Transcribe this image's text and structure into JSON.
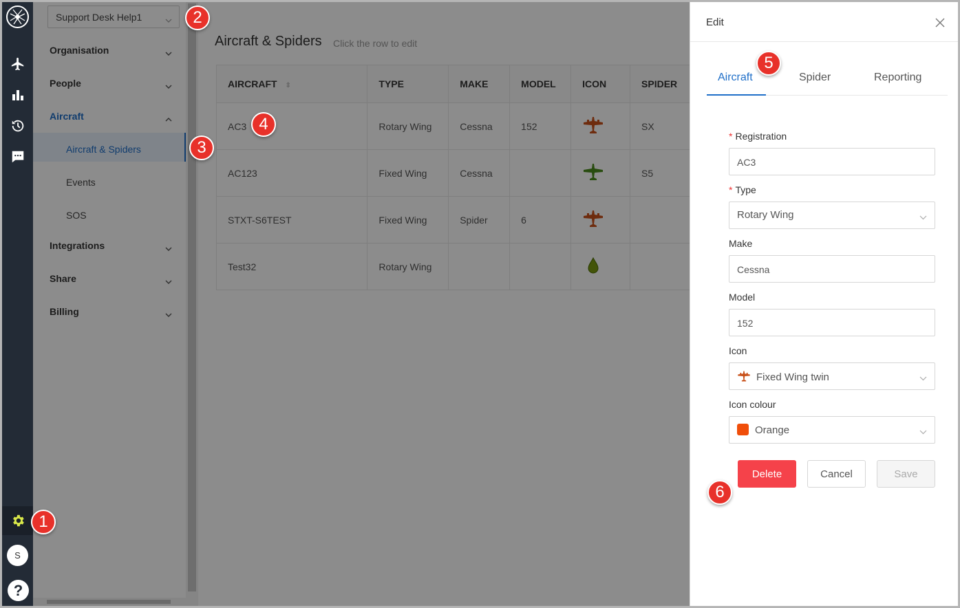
{
  "workspace": {
    "name": "Support Desk Help1"
  },
  "nav": {
    "groups": [
      {
        "label": "Organisation"
      },
      {
        "label": "People"
      },
      {
        "label": "Aircraft"
      },
      {
        "label": "Integrations"
      },
      {
        "label": "Share"
      },
      {
        "label": "Billing"
      }
    ],
    "aircraft_items": [
      {
        "label": "Aircraft & Spiders"
      },
      {
        "label": "Events"
      },
      {
        "label": "SOS"
      }
    ]
  },
  "user": {
    "initial": "S"
  },
  "help": {
    "glyph": "?"
  },
  "main": {
    "title": "Aircraft & Spiders",
    "hint": "Click the row to edit",
    "columns": [
      "AIRCRAFT",
      "TYPE",
      "MAKE",
      "MODEL",
      "ICON",
      "SPIDER"
    ],
    "rows": [
      {
        "aircraft": "AC3",
        "type": "Rotary Wing",
        "make": "Cessna",
        "model": "152",
        "icon": "orange-plane-icon",
        "spider": "SX"
      },
      {
        "aircraft": "AC123",
        "type": "Fixed Wing",
        "make": "Cessna",
        "model": "",
        "icon": "green-plane-icon",
        "spider": "S5"
      },
      {
        "aircraft": "STXT-S6TEST",
        "type": "Fixed Wing",
        "make": "Spider",
        "model": "6",
        "icon": "orange-plane-icon",
        "spider": ""
      },
      {
        "aircraft": "Test32",
        "type": "Rotary Wing",
        "make": "",
        "model": "",
        "icon": "green-drop-icon",
        "spider": ""
      }
    ]
  },
  "drawer": {
    "title": "Edit",
    "tabs": [
      "Aircraft",
      "Spider",
      "Reporting"
    ],
    "fields": {
      "registration_label": "Registration",
      "registration_value": "AC3",
      "type_label": "Type",
      "type_value": "Rotary Wing",
      "make_label": "Make",
      "make_value": "Cessna",
      "model_label": "Model",
      "model_value": "152",
      "icon_label": "Icon",
      "icon_value": "Fixed Wing twin",
      "colour_label": "Icon colour",
      "colour_value": "Orange"
    },
    "buttons": {
      "delete": "Delete",
      "cancel": "Cancel",
      "save": "Save"
    }
  },
  "callouts": [
    "1",
    "2",
    "3",
    "4",
    "5",
    "6"
  ],
  "colors": {
    "accent": "#1e6ec8",
    "danger": "#f5424a",
    "rail": "#232b36",
    "icon_orange": "#c8511a",
    "icon_green": "#4a8a1c",
    "swatch_orange": "#f04e0a",
    "gear": "#d9e84a"
  }
}
